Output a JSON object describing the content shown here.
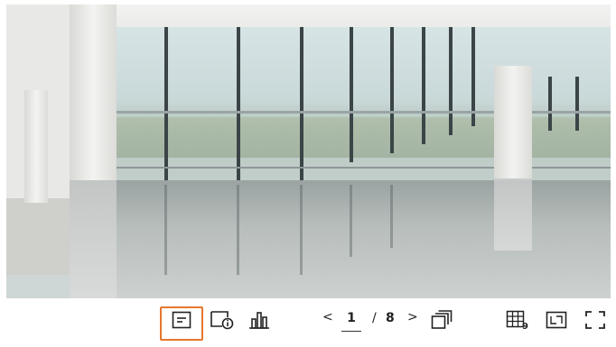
{
  "toolbar": {
    "pagination": {
      "prev_glyph": "<",
      "current_page": "1",
      "separator": "/",
      "total_pages": "8",
      "next_glyph": ">"
    },
    "icons": {
      "event_list": "list-icon",
      "camera_info": "camera-info-icon",
      "statistics": "bar-chart-icon",
      "sequence": "sequence-icon",
      "layout_split": "layout-9-icon",
      "fit_screen": "fit-screen-icon",
      "fullscreen": "fullscreen-icon"
    },
    "highlight_color": "#e8772e"
  }
}
